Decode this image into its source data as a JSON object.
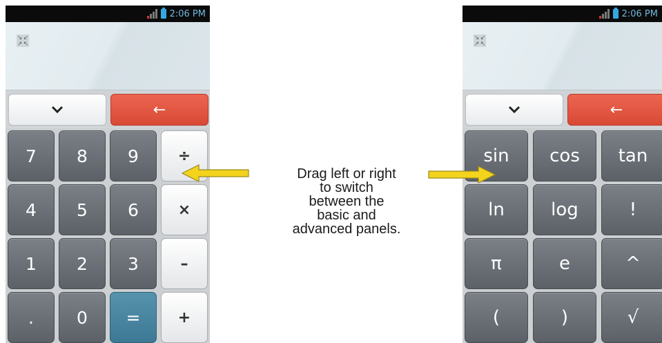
{
  "status_bar": {
    "time": "2:06 PM"
  },
  "display": {
    "icon": "collapse-arrows-icon"
  },
  "top_row": {
    "collapse_icon": "chevron-down-icon",
    "back_icon": "backspace-arrow-icon",
    "back_glyph": "←",
    "back_color": "#e0523d"
  },
  "basic_keys": [
    [
      "7",
      "8",
      "9",
      "÷"
    ],
    [
      "4",
      "5",
      "6",
      "×"
    ],
    [
      "1",
      "2",
      "3",
      "–"
    ],
    [
      ".",
      "0",
      "=",
      "+"
    ]
  ],
  "advanced_keys": [
    [
      "sin",
      "cos",
      "tan"
    ],
    [
      "ln",
      "log",
      "!"
    ],
    [
      "π",
      "e",
      "^"
    ],
    [
      "(",
      ")",
      "√"
    ]
  ],
  "caption_lines": [
    "Drag left or right",
    "to switch",
    "between the",
    "basic and",
    "advanced panels."
  ],
  "arrow_color": "#f3d31c"
}
